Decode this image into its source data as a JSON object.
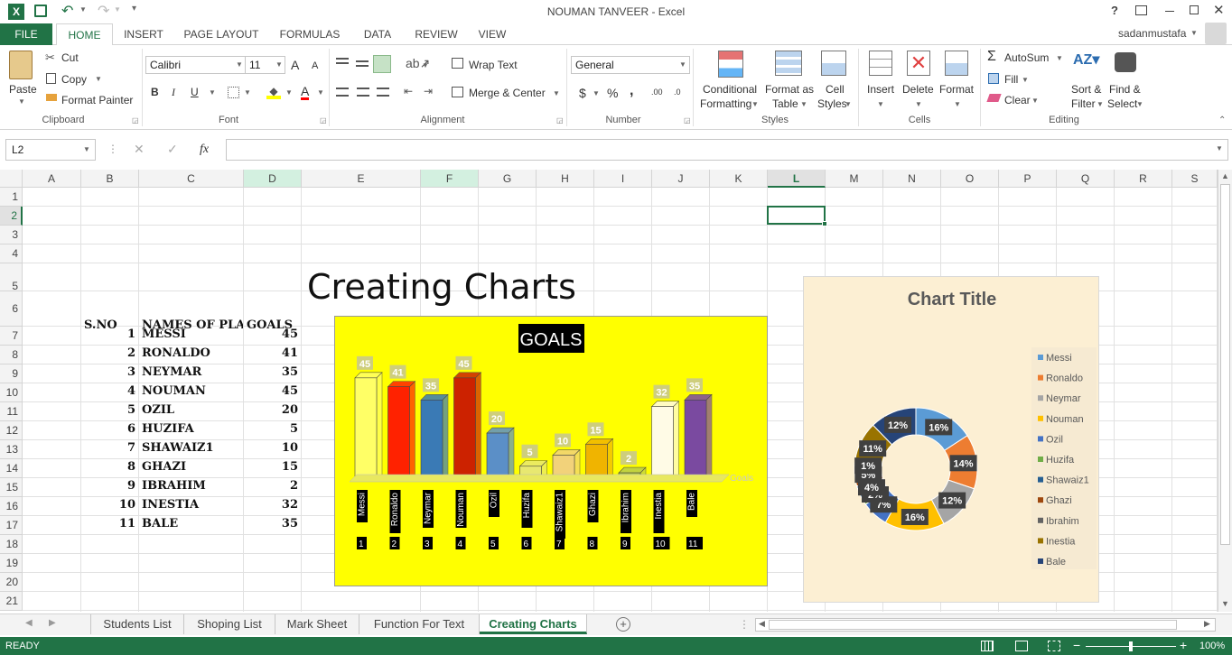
{
  "title": "NOUMAN TANVEER - Excel",
  "user": "sadanmustafa",
  "tabs": [
    "FILE",
    "HOME",
    "INSERT",
    "PAGE LAYOUT",
    "FORMULAS",
    "DATA",
    "REVIEW",
    "VIEW"
  ],
  "ribbon": {
    "clipboard": {
      "paste": "Paste",
      "cut": "Cut",
      "copy": "Copy",
      "format_painter": "Format Painter",
      "label": "Clipboard"
    },
    "font": {
      "name": "Calibri",
      "size": "11",
      "label": "Font",
      "bold": "B",
      "italic": "I",
      "underline": "U",
      "grow": "A",
      "shrink": "A",
      "fontcolor": "A"
    },
    "alignment": {
      "wrap": "Wrap Text",
      "merge": "Merge & Center",
      "label": "Alignment"
    },
    "number": {
      "format": "General",
      "currency": "$",
      "percent": "%",
      "comma": ",",
      "inc_dec": ".00",
      "dec_dec": ".0",
      "label": "Number"
    },
    "styles": {
      "cond_line1": "Conditional",
      "cond_line2": "Formatting",
      "fmt_line1": "Format as",
      "fmt_line2": "Table",
      "cell_line1": "Cell",
      "cell_line2": "Styles",
      "label": "Styles"
    },
    "cells": {
      "insert": "Insert",
      "delete": "Delete",
      "format": "Format",
      "label": "Cells"
    },
    "editing": {
      "autosum": "AutoSum",
      "fill": "Fill",
      "clear": "Clear",
      "sort_line1": "Sort &",
      "sort_line2": "Filter",
      "find_line1": "Find &",
      "find_line2": "Select",
      "label": "Editing"
    }
  },
  "namebox": "L2",
  "fx": "fx",
  "columns": [
    "A",
    "B",
    "C",
    "D",
    "E",
    "F",
    "G",
    "H",
    "I",
    "J",
    "K",
    "L",
    "M",
    "N",
    "O",
    "P",
    "Q",
    "R",
    "S"
  ],
  "rows": [
    "1",
    "2",
    "3",
    "4",
    "5",
    "6",
    "7",
    "8",
    "9",
    "10",
    "11",
    "12",
    "13",
    "14",
    "15",
    "16",
    "17",
    "18",
    "19",
    "20",
    "21"
  ],
  "sheet": {
    "heading": "Creating Charts",
    "headers": {
      "sno": "S.NO",
      "names": "NAMES OF PLAYERS",
      "goals": "GOALS"
    },
    "table": [
      {
        "sno": "1",
        "name": "MESSI",
        "goals": "45"
      },
      {
        "sno": "2",
        "name": "RONALDO",
        "goals": "41"
      },
      {
        "sno": "3",
        "name": "NEYMAR",
        "goals": "35"
      },
      {
        "sno": "4",
        "name": "NOUMAN",
        "goals": "45"
      },
      {
        "sno": "5",
        "name": "OZIL",
        "goals": "20"
      },
      {
        "sno": "6",
        "name": "HUZIFA",
        "goals": "5"
      },
      {
        "sno": "7",
        "name": "SHAWAIZ1",
        "goals": "10"
      },
      {
        "sno": "8",
        "name": "GHAZI",
        "goals": "15"
      },
      {
        "sno": "9",
        "name": "IBRAHIM",
        "goals": "2"
      },
      {
        "sno": "10",
        "name": "INESTIA",
        "goals": "32"
      },
      {
        "sno": "11",
        "name": "BALE",
        "goals": "35"
      }
    ]
  },
  "chart_data": [
    {
      "type": "bar",
      "title": "GOALS",
      "categories": [
        "Messi",
        "Ronaldo",
        "Neymar",
        "Nouman",
        "Ozil",
        "Huzifa",
        "Shawaiz1",
        "Ghazi",
        "Ibrahim",
        "Inestia",
        "Bale"
      ],
      "category_numbers": [
        "1",
        "2",
        "3",
        "4",
        "5",
        "6",
        "7",
        "8",
        "9",
        "10",
        "11"
      ],
      "series": [
        {
          "name": "Goals",
          "values": [
            45,
            41,
            35,
            45,
            20,
            5,
            10,
            15,
            2,
            32,
            35
          ]
        }
      ],
      "colors": [
        "#ffff66",
        "#ff2200",
        "#3a7ab5",
        "#cc2200",
        "#5b8fc7",
        "#e8e870",
        "#f2d27a",
        "#f0b400",
        "#b8cc4a",
        "#fffbe6",
        "#7a4aa0"
      ],
      "background": "#ffff00"
    },
    {
      "type": "pie",
      "title": "Chart Title",
      "categories": [
        "Messi",
        "Ronaldo",
        "Neymar",
        "Nouman",
        "Ozil",
        "Huzifa",
        "Shawaiz1",
        "Ghazi",
        "Ibrahim",
        "Inestia",
        "Bale"
      ],
      "values": [
        45,
        41,
        35,
        45,
        20,
        5,
        10,
        15,
        2,
        32,
        35
      ],
      "labels": [
        "16%",
        "14%",
        "12%",
        "16%",
        "7%",
        "2%",
        "4%",
        "5%",
        "1%",
        "11%",
        "12%"
      ],
      "colors": [
        "#5b9bd5",
        "#ed7d31",
        "#a5a5a5",
        "#ffc000",
        "#4472c4",
        "#70ad47",
        "#255e91",
        "#9e480e",
        "#636363",
        "#997300",
        "#264478"
      ],
      "background": "#fcefd3"
    }
  ],
  "sheet_tabs": [
    "Students List",
    "Shoping List",
    "Mark Sheet",
    "Function For Text",
    "Creating Charts"
  ],
  "status": {
    "ready": "READY",
    "zoom": "100%"
  },
  "accent": "#217346"
}
